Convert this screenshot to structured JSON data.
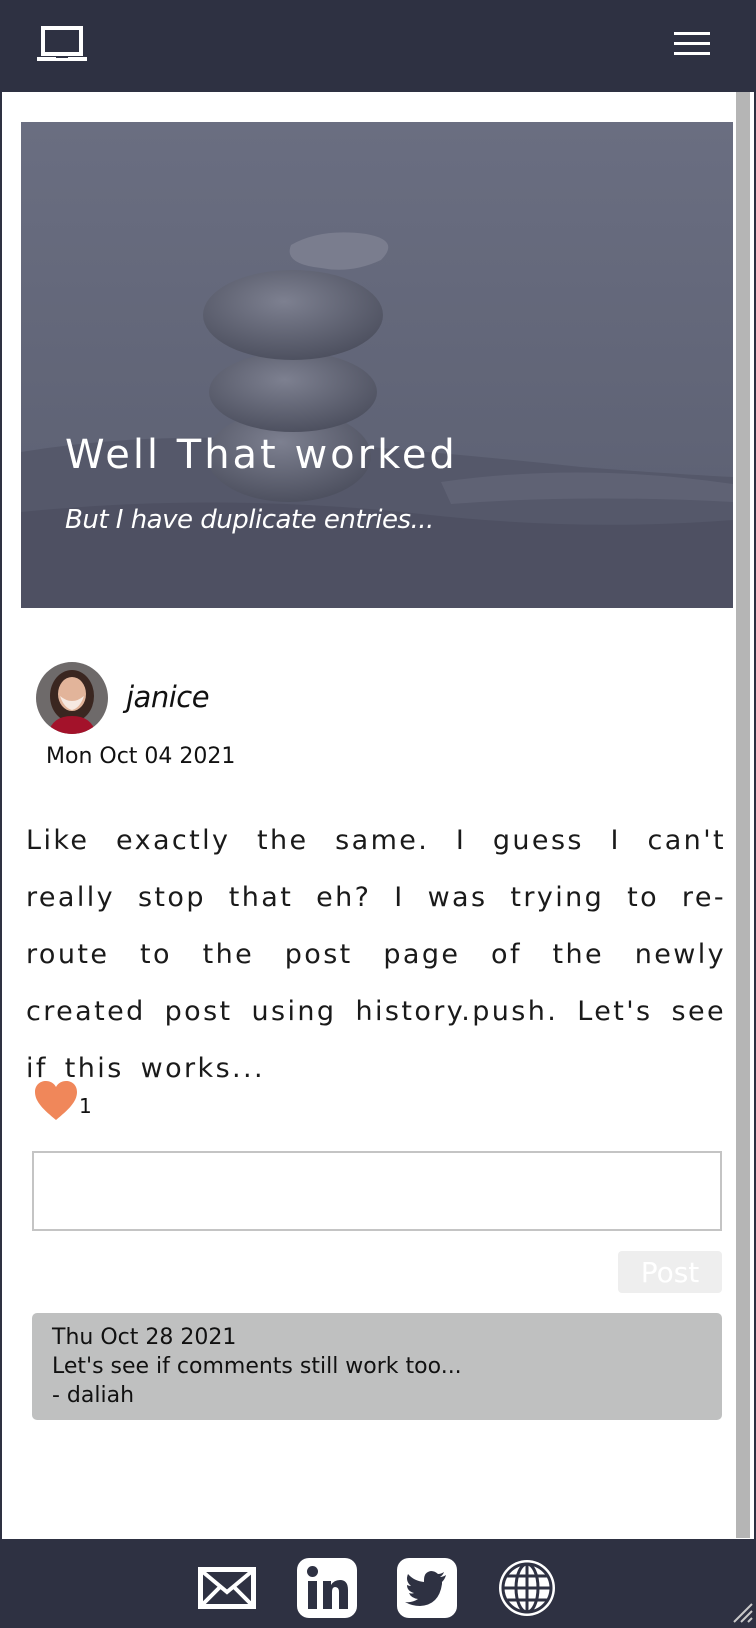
{
  "header": {
    "logo_icon": "laptop-icon",
    "menu_icon": "hamburger-menu-icon"
  },
  "hero": {
    "title": "Well That worked",
    "subtitle": "But I have duplicate entries..."
  },
  "post": {
    "author": "janice",
    "date": "Mon Oct 04 2021",
    "body": "Like exactly the same. I guess I can't really stop that eh? I was trying to re-route to the post page of the newly created post using history.push. Let's see if this works...",
    "likes": "1"
  },
  "comment_form": {
    "input_value": "",
    "post_label": "Post"
  },
  "comments": [
    {
      "date": "Thu Oct 28 2021",
      "text": "Let's see if comments still work too...",
      "author": "- daliah"
    }
  ],
  "footer": {
    "icons": [
      "mail-icon",
      "linkedin-icon",
      "twitter-icon",
      "globe-icon"
    ]
  },
  "colors": {
    "navbar": "#2e3142",
    "heart": "#f0875a",
    "comment_bg": "#bfc0c0",
    "post_button_bg": "#eeeeee"
  }
}
